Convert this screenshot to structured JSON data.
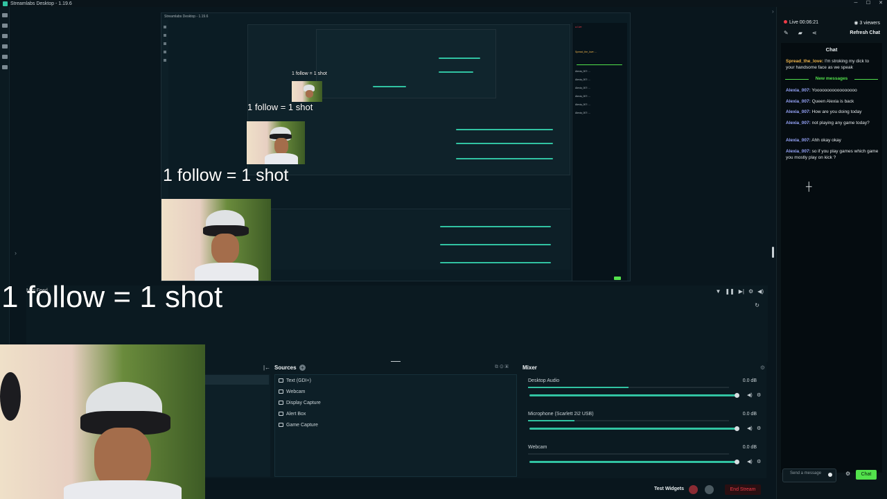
{
  "window": {
    "title": "Streamlabs Desktop - 1.19.6"
  },
  "caption_text": "1 follow = 1 shot",
  "main_panel": {
    "label": "Mini Feed"
  },
  "sources": {
    "title": "Sources",
    "items": [
      {
        "label": "Text (GDI+)"
      },
      {
        "label": "Webcam"
      },
      {
        "label": "Display Capture"
      },
      {
        "label": "Alert Box"
      },
      {
        "label": "Game Capture"
      }
    ]
  },
  "mixer": {
    "title": "Mixer",
    "channels": [
      {
        "name": "Desktop Audio",
        "db": "0.0 dB",
        "level": 0.5
      },
      {
        "name": "Microphone (Scarlett 2i2 USB)",
        "db": "0.0 dB",
        "level": 0.23
      },
      {
        "name": "Webcam",
        "db": "0.0 dB",
        "level": 0.0
      }
    ]
  },
  "footer": {
    "test_widgets": "Test Widgets",
    "end_stream": "End Stream"
  },
  "chat": {
    "live": "Live 00:06:21",
    "viewers": "3 viewers",
    "refresh": "Refresh Chat",
    "title": "Chat",
    "new_messages": "New messages",
    "first": {
      "user": "Spread_the_love:",
      "text": "I'm stroking my dick to your handsome face as we speak"
    },
    "messages": [
      {
        "user": "Alexia_007:",
        "text": "Yooooooooooooooooo"
      },
      {
        "user": "Alexia_007:",
        "text": "Queen Alexia is back"
      },
      {
        "user": "Alexia_007:",
        "text": "How are you doing today"
      },
      {
        "user": "Alexia_007:",
        "text": "not playing any game today?"
      },
      {
        "user": "Alexia_007:",
        "text": "Ahh okay okay"
      },
      {
        "user": "Alexia_007:",
        "text": "so if you play games which game you mostly play on kick ?"
      }
    ],
    "send_placeholder": "Send a message",
    "chat_button": "Chat"
  },
  "colors": {
    "accent": "#31c3a2",
    "chat_green": "#53e24c",
    "live_red": "#ef3b47",
    "bg": "#09161d"
  }
}
